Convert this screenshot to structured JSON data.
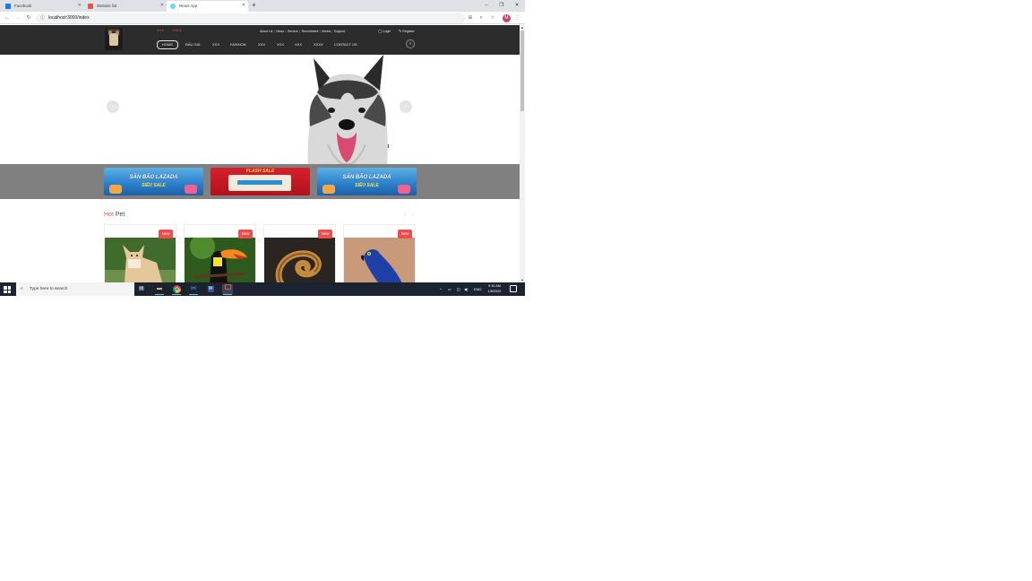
{
  "browser": {
    "tabs": [
      {
        "title": "Facebook",
        "favicon_color": "#1877f2",
        "active": false
      },
      {
        "title": "Website list",
        "favicon_color": "#e2574c",
        "active": false
      },
      {
        "title": "React App",
        "favicon_color": "#61dafb",
        "active": true
      }
    ],
    "new_tab": "+",
    "window_controls": {
      "minimize": "–",
      "maximize": "❐",
      "close": "✕"
    },
    "nav": {
      "back": "←",
      "forward": "→",
      "reload": "↻"
    },
    "url": "localhost:3000/index",
    "info_icon": "ⓘ",
    "toolbar_icons": {
      "translate": "⊞",
      "zoom": "⌕",
      "bookmark": "☆",
      "menu": "⋮"
    },
    "profile_initial": "M"
  },
  "site": {
    "lang": {
      "vn": "VN ▾",
      "usd": "VND ▾"
    },
    "top_links": [
      "About Us",
      "News",
      "Service",
      "Recruitment",
      "Media",
      "Support"
    ],
    "auth": {
      "login": "Login",
      "register": "Register"
    },
    "nav": [
      "HOME",
      "ĐẤU GIÁ",
      "XXX",
      "FASHION",
      "XXX",
      "XXX",
      "XXX",
      "XXXX",
      "CONTACT US"
    ],
    "search_icon": "⌕"
  },
  "hero": {
    "prev": "‹",
    "next": "›"
  },
  "banners": [
    {
      "type": "lazada",
      "line1": "SĂN BÃO LAZADA",
      "line2": "SIÊU SALE"
    },
    {
      "type": "red",
      "line1": "FLASH SALE"
    },
    {
      "type": "lazada",
      "line1": "SĂN BÃO LAZADA",
      "line2": "SIÊU SALE"
    }
  ],
  "hot_pet": {
    "title_hot": "Hot",
    "title_pet": " Pet",
    "prev": "‹",
    "next": "›",
    "badge": "New",
    "cards": [
      "akita",
      "toucan",
      "snake",
      "macaw"
    ]
  },
  "taskbar": {
    "search_placeholder": "Type here to search",
    "search_icon": "⌕",
    "tray": {
      "chevron": "^",
      "lang": "ENG"
    },
    "time": "9:10 AM",
    "date": "1/8/2020"
  }
}
